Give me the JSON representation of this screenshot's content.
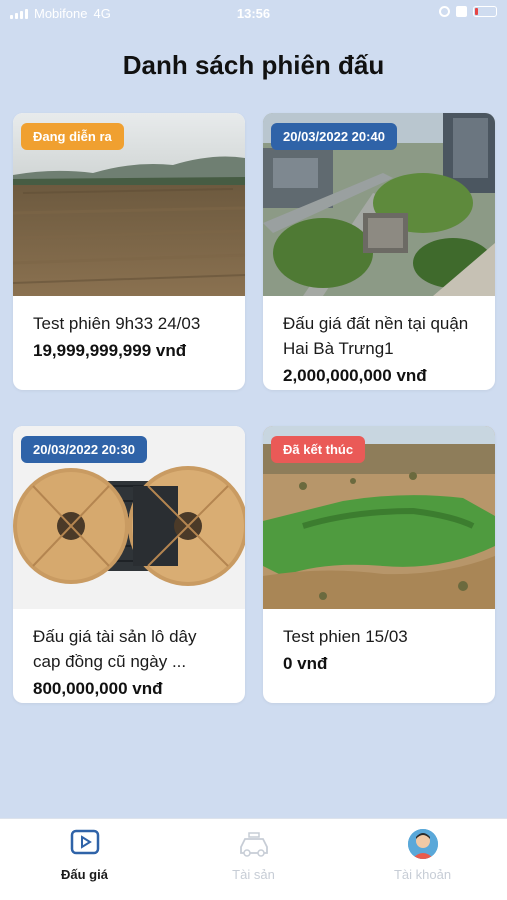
{
  "status_bar": {
    "carrier": "Mobifone",
    "network": "4G",
    "time": "13:56"
  },
  "page": {
    "title": "Danh sách phiên đấu"
  },
  "auctions": [
    {
      "title": "Test phiên 9h33 24/03",
      "price": "19,999,999,999 vnđ",
      "badge": "Đang diễn ra",
      "badge_color": "#f0a030"
    },
    {
      "title": "Đấu giá đất nền tại quận Hai Bà Trưng1",
      "price": "2,000,000,000 vnđ",
      "badge": "20/03/2022 20:40",
      "badge_color": "#2f63a8"
    },
    {
      "title": "Đấu giá tài sản lô dây cap đồng cũ ngày ...",
      "price": "800,000,000 vnđ",
      "badge": "20/03/2022 20:30",
      "badge_color": "#2f63a8"
    },
    {
      "title": "Test phien 15/03",
      "price": "0 vnđ",
      "badge": "Đã kết thúc",
      "badge_color": "#ea5a57"
    }
  ],
  "tabs": [
    {
      "label": "Đấu giá",
      "icon": "play-icon",
      "active": true
    },
    {
      "label": "Tài sản",
      "icon": "car-icon",
      "active": false
    },
    {
      "label": "Tài khoản",
      "icon": "avatar-icon",
      "active": false
    }
  ],
  "colors": {
    "background": "#cfdcf0",
    "active_tab": "#2f63a8",
    "inactive_tab": "#c7cdd6"
  }
}
